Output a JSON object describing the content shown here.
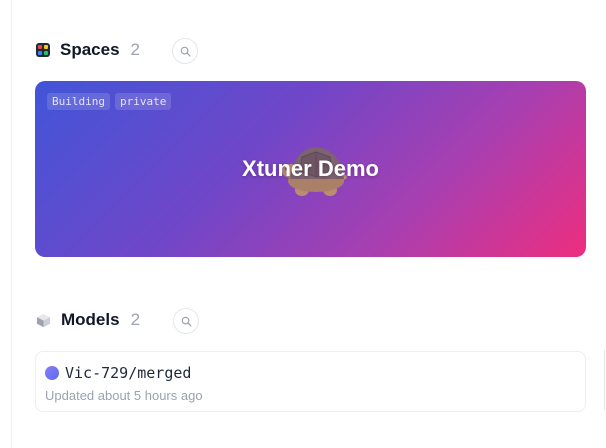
{
  "spaces": {
    "title": "Spaces",
    "count": "2",
    "icon": "spaces-grid-icon",
    "items": [
      {
        "title": "Xtuner Demo",
        "tags": [
          "Building",
          "private"
        ],
        "emoji": "turtle",
        "gradient_colors": [
          "#4155d8",
          "#7146c8",
          "#ee2d7f"
        ]
      }
    ]
  },
  "models": {
    "title": "Models",
    "count": "2",
    "icon": "cube-icon",
    "items": [
      {
        "name": "Vic-729/merged",
        "updated": "Updated about 5 hours ago"
      }
    ]
  },
  "colors": {
    "accent": "#4155d8",
    "text_primary": "#111827",
    "text_muted": "#9ca3af"
  }
}
